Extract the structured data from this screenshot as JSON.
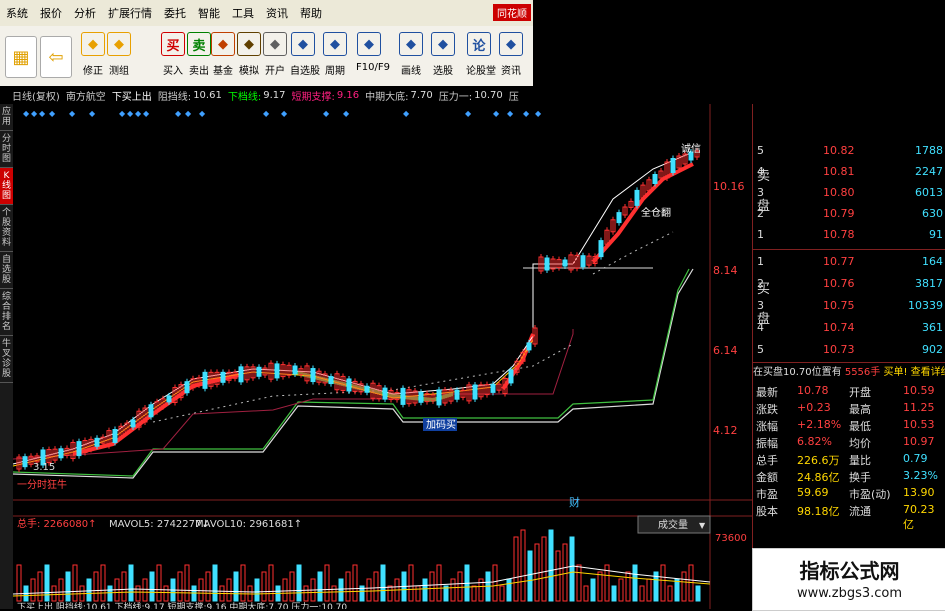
{
  "menu": {
    "items": [
      "系统",
      "报价",
      "分析",
      "扩展行情",
      "委托",
      "智能",
      "工具",
      "资讯",
      "帮助"
    ],
    "brand": "同花顺"
  },
  "toolbar": {
    "buttons": [
      {
        "label": "修正",
        "icon": "revise-icon",
        "color": "#e8a000"
      },
      {
        "label": "测组",
        "icon": "group-icon",
        "color": "#e8a000"
      },
      {
        "label": "买入",
        "icon": "buy-icon",
        "color": "#d00000",
        "glyph": "买"
      },
      {
        "label": "卖出",
        "icon": "sell-icon",
        "color": "#008000",
        "glyph": "卖"
      },
      {
        "label": "基金",
        "icon": "fund-icon",
        "color": "#c04000"
      },
      {
        "label": "模拟",
        "icon": "simulate-icon",
        "color": "#604000"
      },
      {
        "label": "开户",
        "icon": "open-account-icon",
        "color": "#606060"
      },
      {
        "label": "自选股",
        "icon": "watchlist-icon",
        "color": "#2050a0"
      },
      {
        "label": "周期",
        "icon": "period-icon",
        "color": "#2050a0"
      },
      {
        "label": "F10/F9",
        "icon": "f10-icon",
        "color": "#2050a0"
      },
      {
        "label": "画线",
        "icon": "draw-line-icon",
        "color": "#2050a0"
      },
      {
        "label": "选股",
        "icon": "stock-pick-icon",
        "color": "#2050a0"
      },
      {
        "label": "论股堂",
        "icon": "forum-icon",
        "color": "#2050a0",
        "glyph": "论"
      },
      {
        "label": "资讯",
        "icon": "news-icon",
        "color": "#2050a0"
      }
    ]
  },
  "infobar": {
    "period": "日线(复权)",
    "stock": "南方航空",
    "signal": "下买上出",
    "resist_label": "阻挡线:",
    "resist_value": "10.61",
    "support_label": "下档线:",
    "support_value": "9.17",
    "short_label": "短期支撑:",
    "short_value": "9.16",
    "mid_label": "中期大底:",
    "mid_value": "7.70",
    "press_label": "压力一:",
    "press_value": "10.70",
    "extra": "压"
  },
  "sidebar": {
    "tabs": [
      "应用",
      "分时图",
      "K线图",
      "个股资料",
      "自选股",
      "综合排名",
      "牛叉诊股"
    ]
  },
  "chart": {
    "price_ticks": [
      "10.16",
      "8.14",
      "6.14",
      "4.12"
    ],
    "price_low": "3.15",
    "annot_high": "诚信",
    "annot_mid": "全仓翻",
    "annot_low": "加码买",
    "annot_left": "一分时狂牛",
    "annot_mark": "财",
    "vol_label": "总手: 2266080↑",
    "mavol5": "MAVOL5: 2742277↓",
    "mavol10": "MAVOL10: 2961681↑",
    "vol_selector": "成交量",
    "vol_tick": "73600",
    "bottom_text": "下买上出 阻挡线:10.61 下档线:9.17 短期支撑:9.16 中期大底:7.70 压力一:10.70"
  },
  "orderbook": {
    "sell_label": "卖盘",
    "buy_label": "买盘",
    "sells": [
      {
        "level": "5",
        "price": "10.82",
        "vol": "1788"
      },
      {
        "level": "4",
        "price": "10.81",
        "vol": "2247"
      },
      {
        "level": "3",
        "price": "10.80",
        "vol": "6013"
      },
      {
        "level": "2",
        "price": "10.79",
        "vol": "630"
      },
      {
        "level": "1",
        "price": "10.78",
        "vol": "91"
      }
    ],
    "buys": [
      {
        "level": "1",
        "price": "10.77",
        "vol": "164"
      },
      {
        "level": "2",
        "price": "10.76",
        "vol": "3817"
      },
      {
        "level": "3",
        "price": "10.75",
        "vol": "10339"
      },
      {
        "level": "4",
        "price": "10.74",
        "vol": "361"
      },
      {
        "level": "5",
        "price": "10.73",
        "vol": "902"
      }
    ],
    "notice": "在买盘10.70位置有",
    "notice_vol": "5556手",
    "notice_action": "买单! 查看详细"
  },
  "quote": [
    {
      "k1": "最新",
      "v1": "10.78",
      "k2": "开盘",
      "v2": "10.59"
    },
    {
      "k1": "涨跌",
      "v1": "+0.23",
      "k2": "最高",
      "v2": "11.25"
    },
    {
      "k1": "涨幅",
      "v1": "+2.18%",
      "k2": "最低",
      "v2": "10.53"
    },
    {
      "k1": "振幅",
      "v1": "6.82%",
      "k2": "均价",
      "v2": "10.97"
    },
    {
      "k1": "总手",
      "v1": "226.6万",
      "k2": "量比",
      "v2": "0.79"
    },
    {
      "k1": "金额",
      "v1": "24.86亿",
      "k2": "换手",
      "v2": "3.23%"
    },
    {
      "k1": "市盈",
      "v1": "59.69",
      "k2": "市盈(动)",
      "v2": "13.90"
    },
    {
      "k1": "股本",
      "v1": "98.18亿",
      "k2": "流通",
      "v2": "70.23亿"
    }
  ],
  "watermark": {
    "title": "指标公式网",
    "url": "www.zbgs3.com"
  },
  "colors": {
    "up": "#ff3030",
    "down": "#40e0ff",
    "price": "#ff4040",
    "vol": "#ffd700",
    "menu_bg": "#ece9d8"
  }
}
